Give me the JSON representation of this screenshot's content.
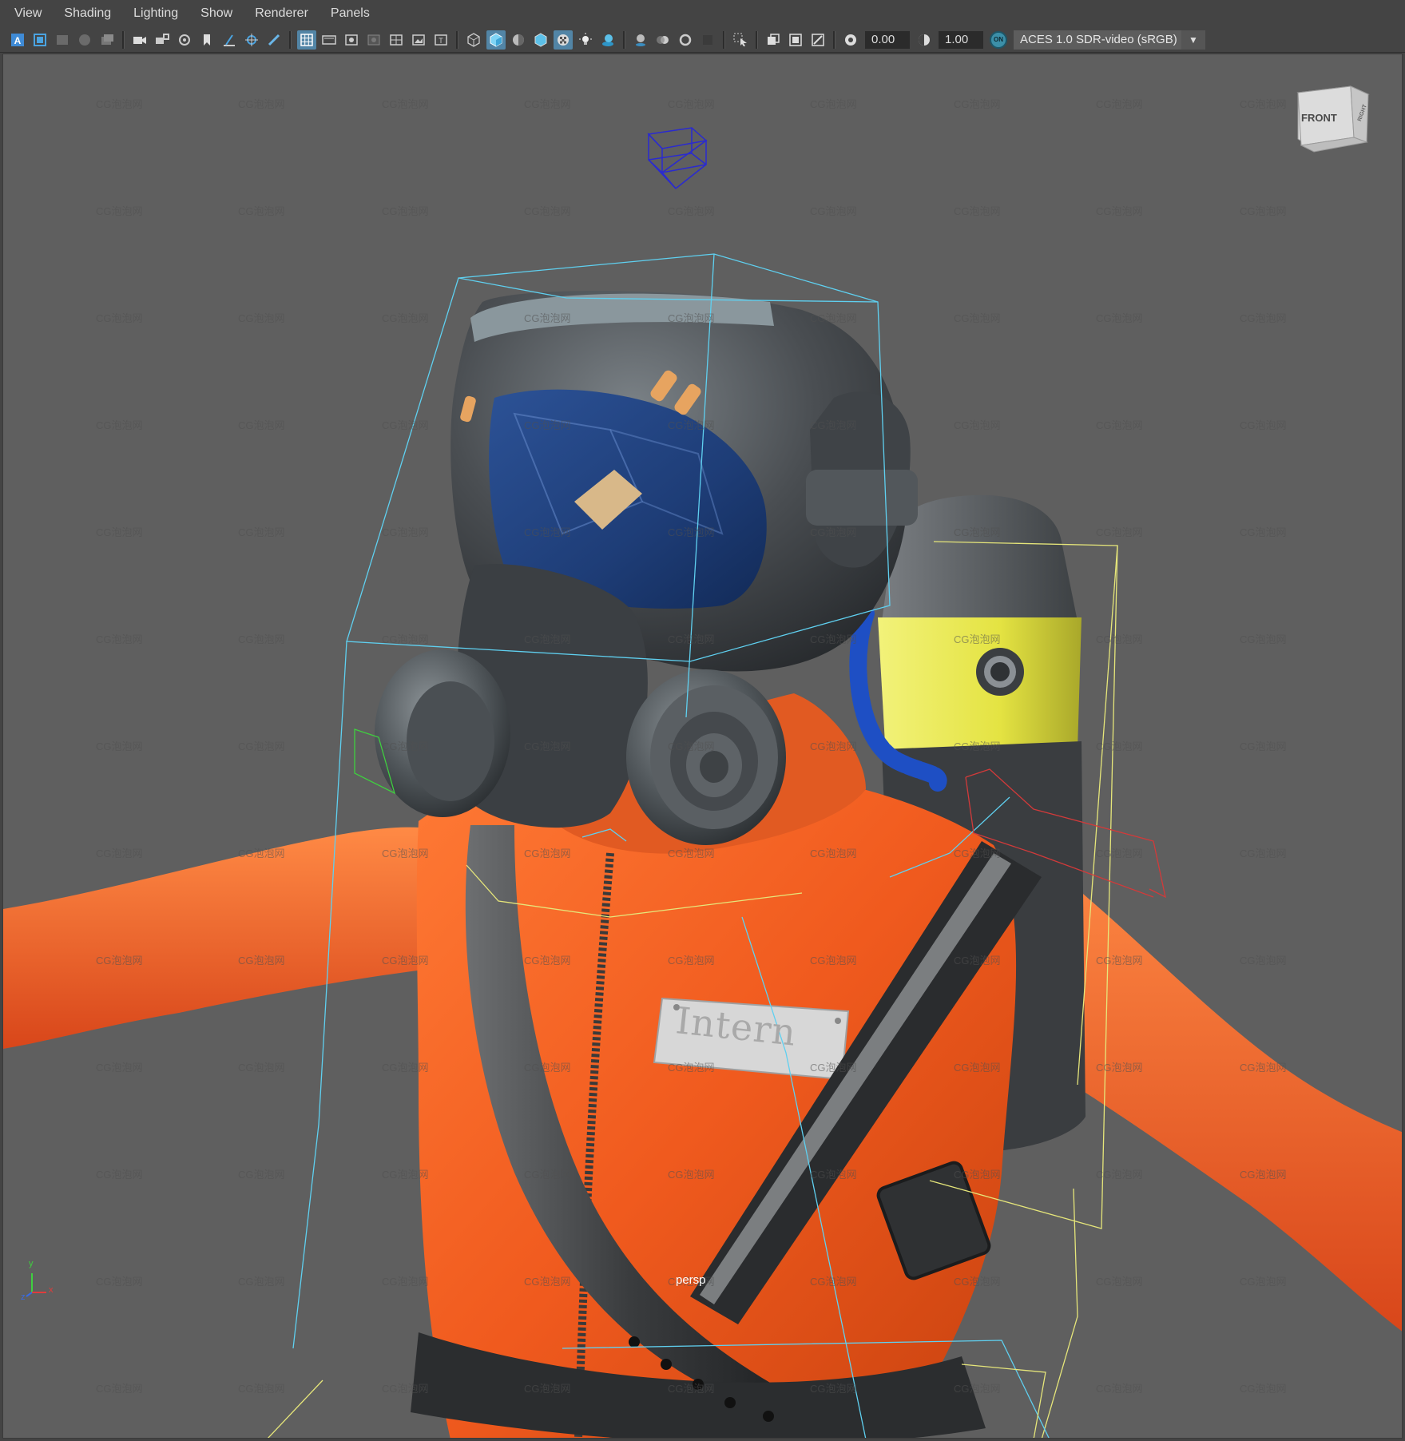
{
  "menubar": {
    "items": [
      "View",
      "Shading",
      "Lighting",
      "Show",
      "Renderer",
      "Panels"
    ]
  },
  "toolbar": {
    "exposure_value": "0.00",
    "gamma_value": "1.00",
    "color_management_badge": "ON",
    "color_space": "ACES 1.0 SDR-video (sRGB)",
    "icons": [
      "select-camera-icon",
      "camera-attributes-icon",
      "bookmarks-icon",
      "image-plane-icon",
      "two-d-pan-zoom-icon",
      "grease-pencil-icon",
      "camera-icon",
      "lock-camera-icon",
      "camera-tools-icon",
      "bookmark-icon",
      "grid-icon",
      "film-gate-icon",
      "resolution-gate-icon",
      "gate-mask-icon",
      "field-chart-icon",
      "safe-action-icon",
      "safe-title-icon",
      "wireframe-icon",
      "smooth-shade-icon",
      "wireframe-on-shaded-icon",
      "default-material-icon",
      "textured-icon",
      "use-all-lights-icon",
      "shadows-icon",
      "screen-space-ao-icon",
      "motion-blur-icon",
      "multisample-aa-icon",
      "depth-of-field-icon",
      "isolate-select-icon",
      "xray-icon",
      "xray-joints-icon",
      "xray-active-components-icon",
      "exposure-icon",
      "gamma-icon"
    ]
  },
  "viewport": {
    "camera_name": "persp",
    "viewcube_front": "FRONT",
    "viewcube_right": "RIGHT",
    "name_tag": "Intern",
    "watermark": "CG泡泡网",
    "axis_labels": {
      "x": "x",
      "y": "y",
      "z": "z"
    }
  },
  "colors": {
    "background": "#444444",
    "viewport_bg": "#5f5f5f",
    "suit_orange": "#f05a1e",
    "visor_blue": "#1f3f7a",
    "tank_yellow": "#e4e342",
    "hose_blue": "#1e4fc4",
    "bbox_cyan": "#5fd0f0",
    "bbox_yellow": "#e6e67a",
    "bbox_red": "#d23a3a",
    "active_button": "#5285a6"
  }
}
